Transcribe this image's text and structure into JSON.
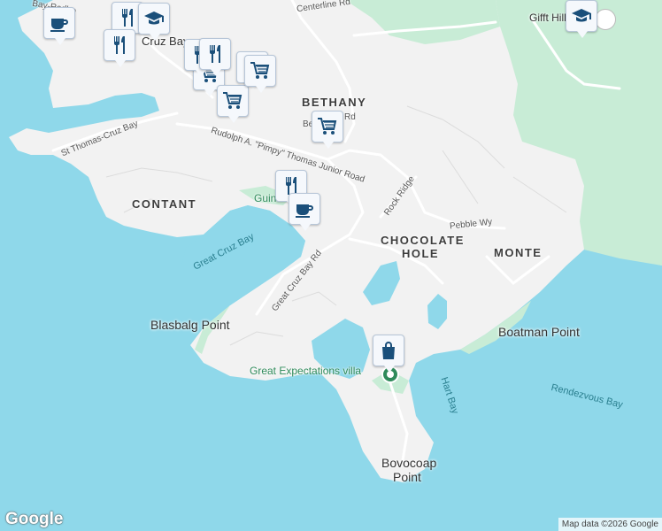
{
  "map": {
    "colors": {
      "water": "#8fd8ea",
      "land": "#f2f2f2",
      "forest": "#c8ecd6",
      "road": "#ffffff",
      "marker": "#f5f8fc",
      "icon": "#1a4f7a",
      "accent": "#2f8a5a"
    }
  },
  "places": {
    "cruz_bay": "Cruz Bay",
    "bethany": "BETHANY",
    "contant": "CONTANT",
    "chocolate_hole": "CHOCOLATE HOLE",
    "monte": "MONTE",
    "gifft_hill_school": "Gifft Hill School"
  },
  "points": {
    "blasbalg": "Blasbalg Point",
    "boatman": "Boatman Point",
    "bovocoap_1": "Bovocoap",
    "bovocoap_2": "Point"
  },
  "water": {
    "great_cruz_bay": "Great Cruz Bay",
    "rendezvous_bay": "Rendezvous Bay",
    "hart_bay": "Hart Bay"
  },
  "roads": {
    "centerline": "Centerline Rd",
    "st_thomas_cruz_bay": "St Thomas-Cruz Bay",
    "rudolph": "Rudolph A. \"Pimpy\" Thomas Junior Road",
    "rock_ridge": "Rock Ridge",
    "pebble": "Pebble Wy",
    "great_cruz_bay_rd": "Great Cruz Bay Rd",
    "bethany_rd_part": "Be",
    "bethany_rd_part2": "Rd",
    "redhook": "Bay-Redho"
  },
  "pois": {
    "great_expectations": "Great Expectations villa",
    "guin": "Guin"
  },
  "markers": [
    {
      "name": "coffee-marker-1",
      "icon": "coffee-icon"
    },
    {
      "name": "restaurant-marker-1",
      "icon": "restaurant-icon"
    },
    {
      "name": "restaurant-marker-2",
      "icon": "restaurant-icon"
    },
    {
      "name": "school-marker-1",
      "icon": "school-icon"
    },
    {
      "name": "grocery-marker-1",
      "icon": "shopping-cart-icon"
    },
    {
      "name": "restaurant-marker-3",
      "icon": "restaurant-icon"
    },
    {
      "name": "restaurant-marker-4",
      "icon": "restaurant-icon"
    },
    {
      "name": "grocery-marker-2",
      "icon": "shopping-cart-icon"
    },
    {
      "name": "restaurant-marker-5",
      "icon": "restaurant-icon"
    },
    {
      "name": "grocery-marker-3",
      "icon": "shopping-cart-icon"
    },
    {
      "name": "grocery-marker-4",
      "icon": "shopping-cart-icon"
    },
    {
      "name": "restaurant-marker-6",
      "icon": "restaurant-icon"
    },
    {
      "name": "coffee-marker-2",
      "icon": "coffee-icon"
    },
    {
      "name": "shopping-bag-marker",
      "icon": "shopping-bag-icon"
    },
    {
      "name": "school-marker-2",
      "icon": "school-icon"
    }
  ],
  "attribution": "Map data ©2026 Google",
  "logo": "Google"
}
